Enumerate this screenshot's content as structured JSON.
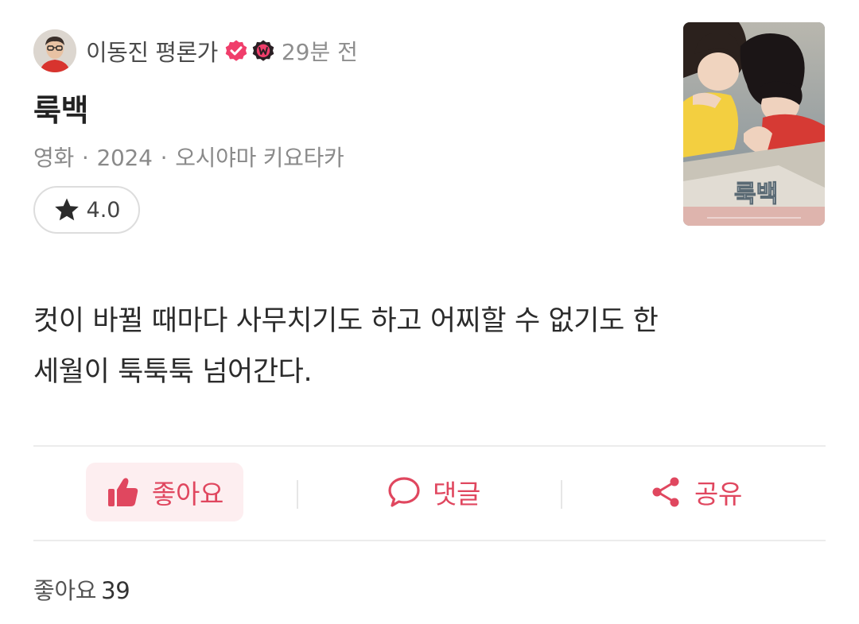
{
  "header": {
    "author": "이동진 평론가",
    "time": "29분 전",
    "avatar": "avatar",
    "badges": [
      "verified-check-icon",
      "watcha-w-icon"
    ]
  },
  "title": "룩백",
  "meta": {
    "type": "영화",
    "year": "2024",
    "director": "오시야마 키요타카",
    "separator": "·"
  },
  "rating": {
    "icon": "star-icon",
    "value": "4.0"
  },
  "poster": {
    "title": "룩백"
  },
  "review": {
    "line1": "컷이 바뀔 때마다 사무치기도 하고 어찌할 수 없기도 한",
    "line2": "세월이 툭툭툭 넘어간다."
  },
  "actions": {
    "like_label": "좋아요",
    "comment_label": "댓글",
    "share_label": "공유"
  },
  "likes": {
    "label": "좋아요",
    "count": "39"
  },
  "colors": {
    "accent": "#e0475f",
    "like_bg": "#fdeef0",
    "badge_pink": "#f03e6b",
    "badge_dark": "#2a1f24"
  }
}
